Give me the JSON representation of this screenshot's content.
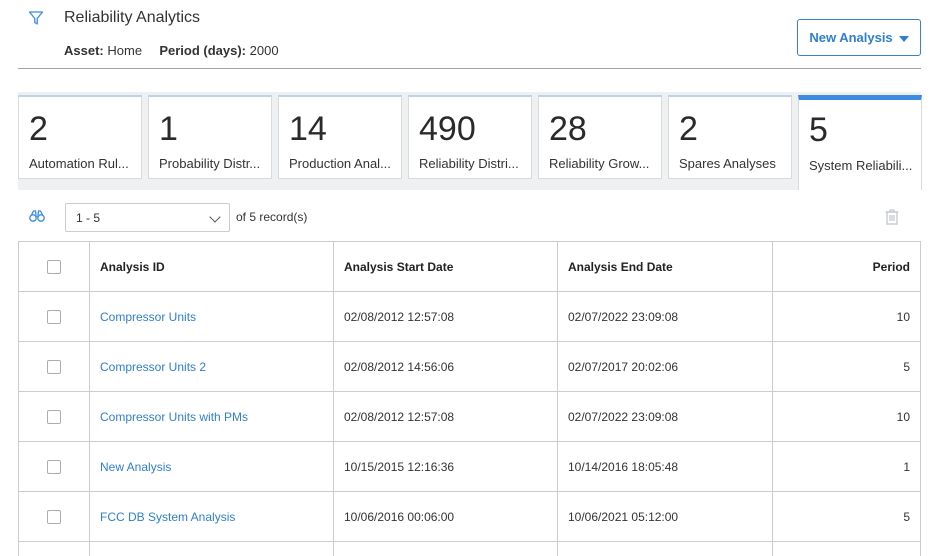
{
  "header": {
    "title": "Reliability Analytics",
    "asset_label": "Asset:",
    "asset_value": "Home",
    "period_label": "Period (days):",
    "period_value": "2000",
    "new_button_label": "New Analysis"
  },
  "tiles": [
    {
      "count": "2",
      "label": "Automation Rul..."
    },
    {
      "count": "1",
      "label": "Probability Distr..."
    },
    {
      "count": "14",
      "label": "Production Anal..."
    },
    {
      "count": "490",
      "label": "Reliability Distri..."
    },
    {
      "count": "28",
      "label": "Reliability Grow..."
    },
    {
      "count": "2",
      "label": "Spares Analyses"
    },
    {
      "count": "5",
      "label": "System Reliabili..."
    }
  ],
  "toolbar": {
    "page_range": "1 - 5",
    "records_text": "of 5 record(s)"
  },
  "table": {
    "columns": [
      "Analysis ID",
      "Analysis Start Date",
      "Analysis End Date",
      "Period"
    ],
    "rows": [
      {
        "id": "Compressor Units",
        "start": "02/08/2012 12:57:08",
        "end": "02/07/2022 23:09:08",
        "period": "10"
      },
      {
        "id": "Compressor Units 2",
        "start": "02/08/2012 14:56:06",
        "end": "02/07/2017 20:02:06",
        "period": "5"
      },
      {
        "id": "Compressor Units with PMs",
        "start": "02/08/2012 12:57:08",
        "end": "02/07/2022 23:09:08",
        "period": "10"
      },
      {
        "id": "New Analysis",
        "start": "10/15/2015 12:16:36",
        "end": "10/14/2016 18:05:48",
        "period": "1"
      },
      {
        "id": "FCC DB System Analysis",
        "start": "10/06/2016 00:06:00",
        "end": "10/06/2021 05:12:00",
        "period": "5"
      }
    ]
  },
  "colors": {
    "accent": "#2f7fd0",
    "active_tab": "#3b8be0"
  }
}
